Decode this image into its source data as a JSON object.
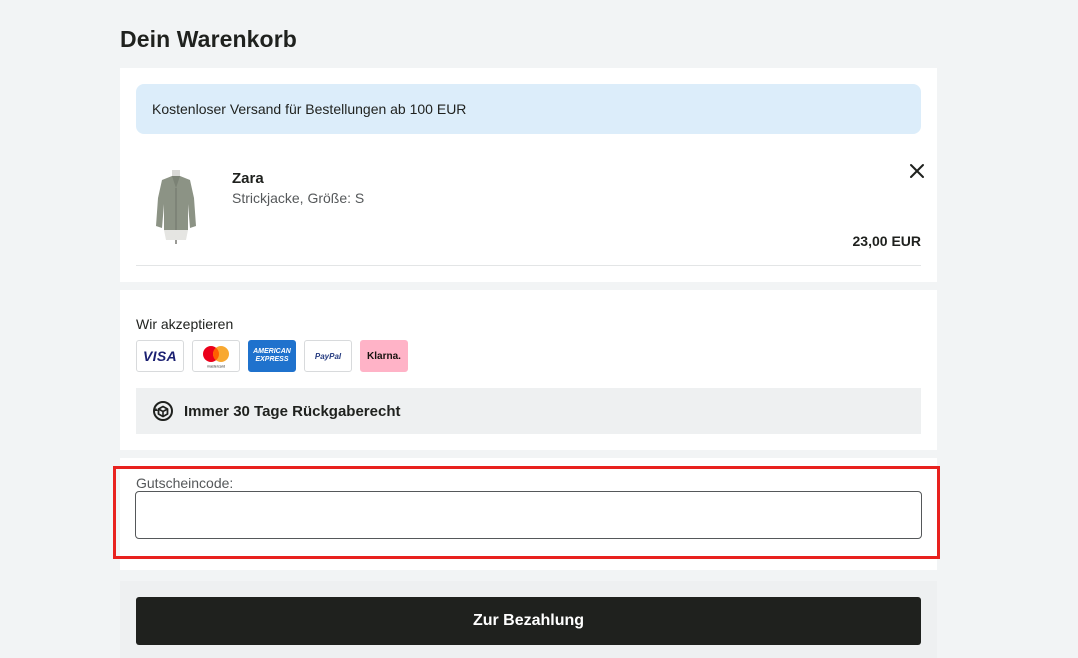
{
  "page": {
    "title": "Dein Warenkorb"
  },
  "cart": {
    "banner": "Kostenloser Versand für Bestellungen ab 100 EUR",
    "item": {
      "brand": "Zara",
      "description": "Strickjacke, Größe: S",
      "price": "23,00 EUR"
    }
  },
  "payments": {
    "label": "Wir akzeptieren",
    "methods": [
      {
        "name": "visa-logo",
        "text": "VISA"
      },
      {
        "name": "mastercard-logo",
        "text": "mastercard"
      },
      {
        "name": "amex-logo",
        "text": "AMERICAN EXPRESS"
      },
      {
        "name": "paypal-logo",
        "text": "PayPal"
      },
      {
        "name": "klarna-logo",
        "text": "Klarna."
      }
    ],
    "returns": "Immer 30 Tage Rückgaberecht"
  },
  "voucher": {
    "label": "Gutscheincode:",
    "value": ""
  },
  "checkout": {
    "button": "Zur Bezahlung"
  },
  "colors": {
    "accent_dark": "#1f211e",
    "banner_bg": "#dcedfa",
    "highlight": "#e8211e"
  }
}
